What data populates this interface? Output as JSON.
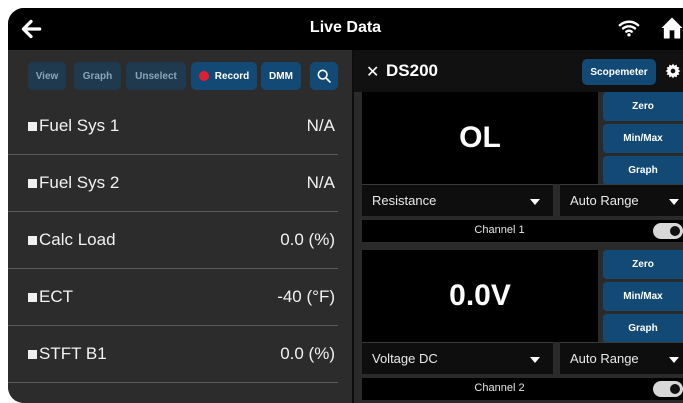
{
  "header": {
    "title": "Live Data",
    "back_icon": "arrow-left-icon",
    "wifi_icon": "wifi-icon",
    "home_icon": "home-icon"
  },
  "toolbar": {
    "view_label": "View",
    "graph_label": "Graph",
    "unselect_label": "Unselect",
    "record_label": "Record",
    "dmm_label": "DMM",
    "search_icon": "search-icon"
  },
  "parameters": [
    {
      "name": "Fuel Sys 1",
      "value": "N/A"
    },
    {
      "name": "Fuel Sys 2",
      "value": "N/A"
    },
    {
      "name": "Calc Load",
      "value": "0.0 (%)"
    },
    {
      "name": "ECT",
      "value": "-40 (°F)"
    },
    {
      "name": "STFT B1",
      "value": "0.0 (%)"
    }
  ],
  "meter": {
    "device": "DS200",
    "scopemeter_label": "Scopemeter",
    "channels": [
      {
        "reading": "OL",
        "zero_label": "Zero",
        "minmax_label": "Min/Max",
        "graph_label": "Graph",
        "mode": "Resistance",
        "range": "Auto Range",
        "channel_label": "Channel 1",
        "enabled": true
      },
      {
        "reading": "0.0V",
        "zero_label": "Zero",
        "minmax_label": "Min/Max",
        "graph_label": "Graph",
        "mode": "Voltage DC",
        "range": "Auto Range",
        "channel_label": "Channel 2",
        "enabled": true
      }
    ]
  },
  "colors": {
    "accent": "#124a75",
    "record": "#e0202e"
  }
}
